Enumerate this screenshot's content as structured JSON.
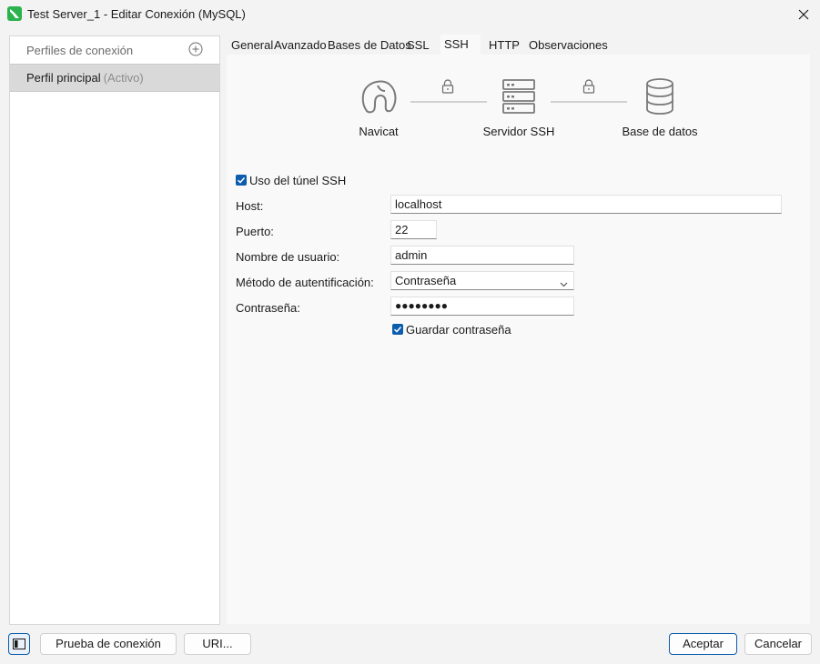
{
  "window": {
    "title": "Test Server_1 - Editar Conexión (MySQL)",
    "app_icon": "navicat-app-icon",
    "close_icon": "close-icon"
  },
  "sidebar": {
    "header": "Perfiles de conexión",
    "add_icon": "add-circle-icon",
    "profiles": [
      {
        "name": "Perfil principal",
        "status": "(Activo)"
      }
    ]
  },
  "tabs": [
    {
      "label": "General"
    },
    {
      "label": "Avanzado"
    },
    {
      "label": "Bases de Datos"
    },
    {
      "label": "SSL"
    },
    {
      "label": "SSH",
      "active": true
    },
    {
      "label": "HTTP"
    },
    {
      "label": "Observaciones"
    }
  ],
  "diagram": {
    "nodes": [
      {
        "label": "Navicat",
        "icon": "navicat-logo-icon"
      },
      {
        "label": "Servidor SSH",
        "icon": "server-icon"
      },
      {
        "label": "Base de datos",
        "icon": "database-icon"
      }
    ],
    "lock_icon": "lock-icon"
  },
  "ssh_form": {
    "use_tunnel_label": "Uso del túnel SSH",
    "use_tunnel_checked": true,
    "host_label": "Host:",
    "host_value": "localhost",
    "port_label": "Puerto:",
    "port_value": "22",
    "username_label": "Nombre de usuario:",
    "username_value": "admin",
    "auth_method_label": "Método de autentificación:",
    "auth_method_value": "Contraseña",
    "password_label": "Contraseña:",
    "password_value": "●●●●●●●●",
    "save_password_label": "Guardar contraseña",
    "save_password_checked": true
  },
  "footer": {
    "toggle_icon": "sidebar-toggle-icon",
    "test_connection": "Prueba de conexión",
    "uri": "URI...",
    "accept": "Aceptar",
    "cancel": "Cancelar"
  },
  "colors": {
    "accent": "#0b5cad",
    "app_icon_green": "#2bb24c"
  }
}
